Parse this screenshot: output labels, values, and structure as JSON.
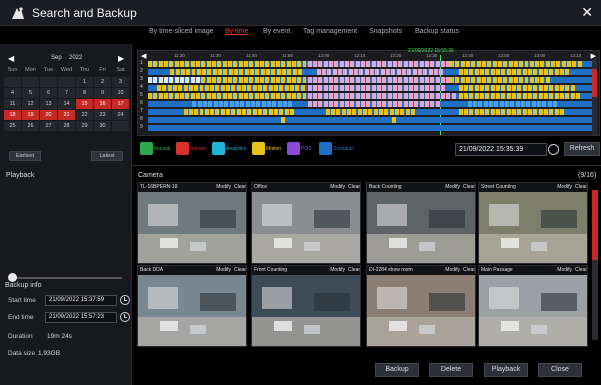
{
  "window": {
    "title": "Search and Backup",
    "close": "✕"
  },
  "tabs": [
    {
      "label": "By time-sliced image"
    },
    {
      "label": "By time"
    },
    {
      "label": "By event"
    },
    {
      "label": "Tag management"
    },
    {
      "label": "Snapshots"
    },
    {
      "label": "Backup status"
    }
  ],
  "calendar": {
    "month": "Sep",
    "year": "2022",
    "weekdays": [
      "Sun",
      "Mon",
      "Tue",
      "Wed",
      "Thu",
      "Fri",
      "Sat"
    ],
    "days": [
      "",
      "",
      "",
      "",
      "1",
      "2",
      "3",
      "4",
      "5",
      "6",
      "7",
      "8",
      "9",
      "10",
      "11",
      "12",
      "13",
      "14",
      "15",
      "16",
      "17",
      "18",
      "19",
      "20",
      "21",
      "22",
      "23",
      "24",
      "25",
      "26",
      "27",
      "28",
      "29",
      "30",
      ""
    ],
    "earliest": "Earliest",
    "latest": "Latest"
  },
  "playback": {
    "label": "Playback"
  },
  "backup_info": {
    "title": "Backup info",
    "start_label": "Start time",
    "start_value": "21/09/2022 15:37:59",
    "end_label": "End time",
    "end_value": "21/09/2022 15:57:23",
    "duration_label": "Duration",
    "duration_value": "19m 24s",
    "size_label": "Data size",
    "size_value": "1.93GB"
  },
  "timeline": {
    "cursor_label": "21/09/2022 15:55:36",
    "ticks": [
      "11:20",
      "11:30",
      "11:40",
      "11:50",
      "12:00",
      "12:10",
      "12:20",
      "12:30",
      "12:40",
      "12:50",
      "13:00",
      "13:10"
    ],
    "rows": [
      "1",
      "2",
      "3",
      "4",
      "5",
      "6",
      "7",
      "8",
      "9"
    ]
  },
  "legend": [
    {
      "label": "Manual",
      "color": "#2fa84f"
    },
    {
      "label": "Sensor",
      "color": "#d8312b"
    },
    {
      "label": "Analytics",
      "color": "#22b3d6"
    },
    {
      "label": "Motion",
      "color": "#e8c21a"
    },
    {
      "label": "POS",
      "color": "#8a4bd6"
    },
    {
      "label": "Schedule",
      "color": "#1f6fc4"
    }
  ],
  "datetime": {
    "value": "21/09/2022 15:35:39"
  },
  "refresh": "Refresh",
  "camera": {
    "label": "Camera",
    "count": "(9/16)"
  },
  "cameras": [
    {
      "name": "TL-16BPERN-18"
    },
    {
      "name": "Office"
    },
    {
      "name": "Back Counting"
    },
    {
      "name": "Street Counting"
    },
    {
      "name": "Back DDA"
    },
    {
      "name": "Front Counting"
    },
    {
      "name": "DI-3284 show room"
    },
    {
      "name": "Main Passage"
    }
  ],
  "cam_actions": {
    "modify": "Modify",
    "clear": "Clear"
  },
  "footer": {
    "backup": "Backup",
    "delete": "Delete",
    "playback": "Playback",
    "close": "Close"
  }
}
